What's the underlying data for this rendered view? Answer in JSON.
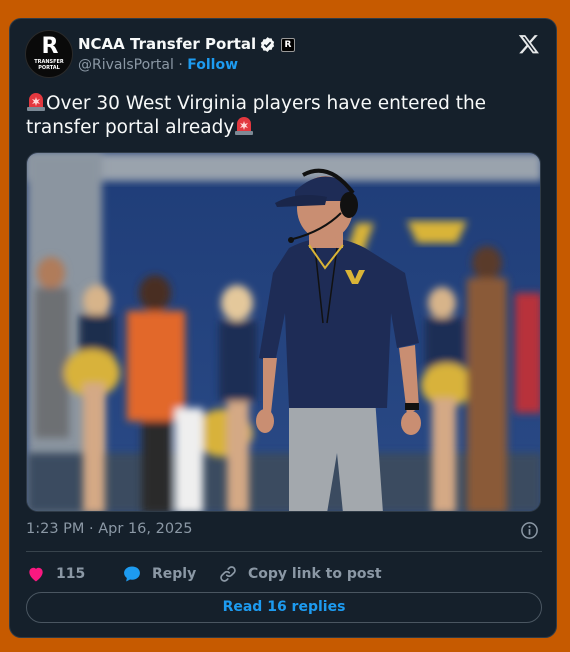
{
  "tweet": {
    "author_name": "NCAA Transfer Portal",
    "handle": "@RivalsPortal",
    "separator": "·",
    "follow_label": "Follow",
    "avatar_letter": "R",
    "avatar_subtext": "TRANSFER PORTAL",
    "text": "Over 30 West Virginia players have entered the transfer portal already",
    "timestamp": "1:23 PM · Apr 16, 2025",
    "like_count": "115",
    "reply_label": "Reply",
    "copy_link_label": "Copy link to post",
    "read_replies_label": "Read 16 replies"
  },
  "icons": {
    "verified": "verified-badge-icon",
    "affiliate": "rivals-affiliate-badge-icon",
    "platform": "x-logo-icon",
    "emoji": "police-siren-emoji",
    "info": "info-icon",
    "like": "heart-icon",
    "reply": "speech-bubble-icon",
    "link": "link-icon"
  },
  "colors": {
    "page_background": "#c65a00",
    "card_background": "#15202b",
    "accent_blue": "#1d9bf0",
    "like_pink": "#f91880",
    "muted_text": "#8b98a5"
  }
}
